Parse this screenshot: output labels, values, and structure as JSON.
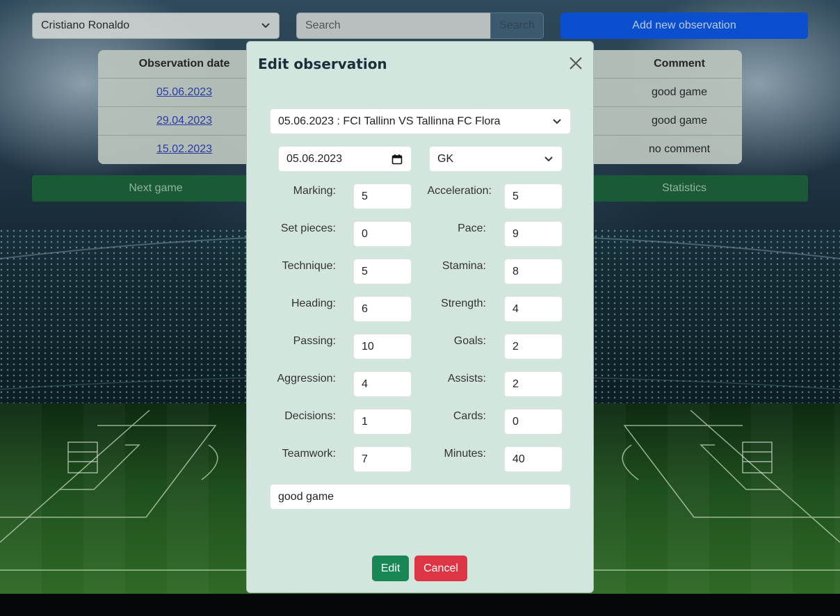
{
  "page": {
    "player_select": "Cristiano Ronaldo",
    "search_placeholder": "Search",
    "search_button": "Search",
    "add_button": "Add new observation",
    "next_button": "Next game",
    "stats_button": "Statistics"
  },
  "table": {
    "columns": [
      "Observation date",
      "Comment"
    ],
    "rows": [
      {
        "date": "05.06.2023",
        "comment": "good game"
      },
      {
        "date": "29.04.2023",
        "comment": "good game"
      },
      {
        "date": "15.02.2023",
        "comment": "no comment"
      }
    ]
  },
  "modal": {
    "title": "Edit observation",
    "game": "05.06.2023 : FCI Tallinn VS Tallinna FC Flora",
    "date": "05.06.2023",
    "position": "GK",
    "left_stats": [
      {
        "label": "Marking:",
        "value": "5"
      },
      {
        "label": "Set pieces:",
        "value": "0"
      },
      {
        "label": "Technique:",
        "value": "5"
      },
      {
        "label": "Heading:",
        "value": "6"
      },
      {
        "label": "Passing:",
        "value": "10"
      },
      {
        "label": "Aggression:",
        "value": "4"
      },
      {
        "label": "Decisions:",
        "value": "1"
      },
      {
        "label": "Teamwork:",
        "value": "7"
      }
    ],
    "right_stats": [
      {
        "label": "Acceleration:",
        "value": "5"
      },
      {
        "label": "Pace:",
        "value": "9"
      },
      {
        "label": "Stamina:",
        "value": "8"
      },
      {
        "label": "Strength:",
        "value": "4"
      },
      {
        "label": "Goals:",
        "value": "2"
      },
      {
        "label": "Assists:",
        "value": "2"
      },
      {
        "label": "Cards:",
        "value": "0"
      },
      {
        "label": "Minutes:",
        "value": "40"
      }
    ],
    "comment": "good game",
    "edit_button": "Edit",
    "cancel_button": "Cancel"
  },
  "colors": {
    "modal_bg": "#d2e6de",
    "edit": "#198754",
    "cancel": "#dc3545",
    "primary": "#0b4fcf",
    "secondary_dark_green": "#1b5a36"
  }
}
